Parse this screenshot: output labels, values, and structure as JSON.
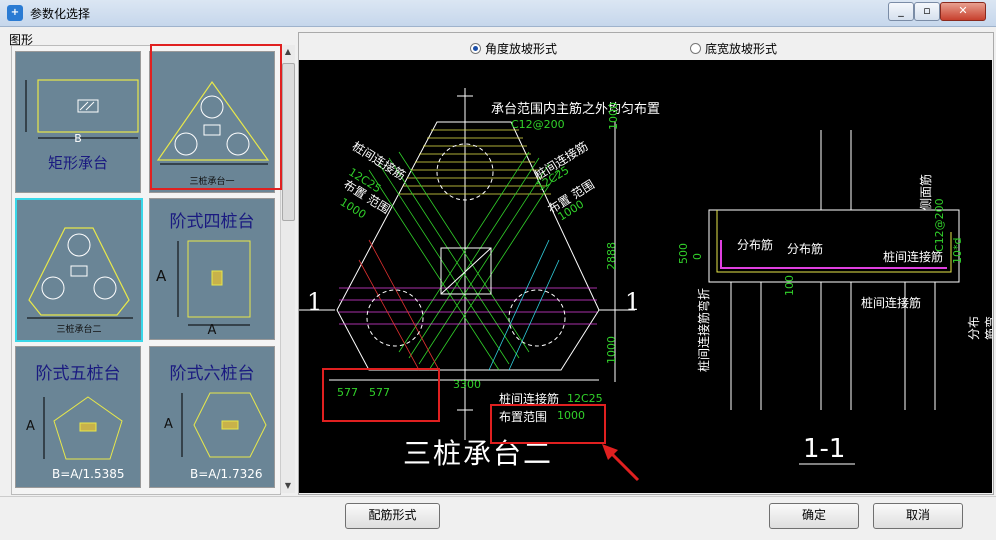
{
  "window": {
    "title": "参数化选择",
    "icon_glyph": "+"
  },
  "left": {
    "group_label": "图形",
    "thumbs": [
      {
        "label": "矩形承台",
        "dim_bottom": "B"
      },
      {
        "label": "三桩承台一",
        "dims": [
          "x4",
          "y2",
          "y3",
          "y1",
          "x1",
          "x2",
          "x3",
          "x1"
        ]
      },
      {
        "label": "三桩承台二",
        "dims": [
          "x4",
          "y2",
          "y3",
          "y1",
          "x1",
          "x2",
          "x3",
          "x1"
        ]
      },
      {
        "label": "阶式四桩台",
        "dim_left": "A",
        "dim_bottom": "A"
      },
      {
        "label": "阶式五桩台",
        "dim_left": "A",
        "dim_bottom": "B=A/1.5385"
      },
      {
        "label": "阶式六桩台",
        "dim_left": "A",
        "dim_bottom": "B=A/1.7326"
      }
    ]
  },
  "options": {
    "radio_angle": "角度放坡形式",
    "radio_width": "底宽放坡形式"
  },
  "drawing": {
    "main_title": "三桩承台二",
    "section_title": "1-1",
    "section_mark": "1",
    "note_top": "承台范围内主筋之外均匀布置",
    "rebar_top": "C12@200",
    "left_label1": "桩间连接筋",
    "left_label2": "12C25",
    "left_label3": "布置 范围",
    "left_label4": "1000",
    "right_label1": "桩间连接筋",
    "right_label2": "12C25",
    "right_label3": "布置 范围",
    "right_label4": "1000",
    "dim_vert1": "1000",
    "dim_vert2": "2888",
    "dim_vert3": "1000",
    "dim_3300": "3300",
    "dim_577a": "577",
    "dim_577b": "577",
    "bottom_label": "桩间连接筋",
    "bottom_rebar": "12C25",
    "bottom_range": "布置范围",
    "bottom_range_val": "1000",
    "sec_dist1": "分布筋",
    "sec_dist2": "分布筋",
    "sec_conn": "桩间连接筋",
    "sec_conn2": "桩间连接筋",
    "sec_side": "侧面筋",
    "sec_side_val": "C12@200",
    "sec_500": "500",
    "sec_0": "0",
    "sec_100": "100",
    "sec_10d": "10*d",
    "sec_vert_left": "桩间连接筋弯折",
    "sec_vert_right": "分布筋弯折"
  },
  "buttons": {
    "rebar_form": "配筋形式",
    "ok": "确定",
    "cancel": "取消"
  }
}
